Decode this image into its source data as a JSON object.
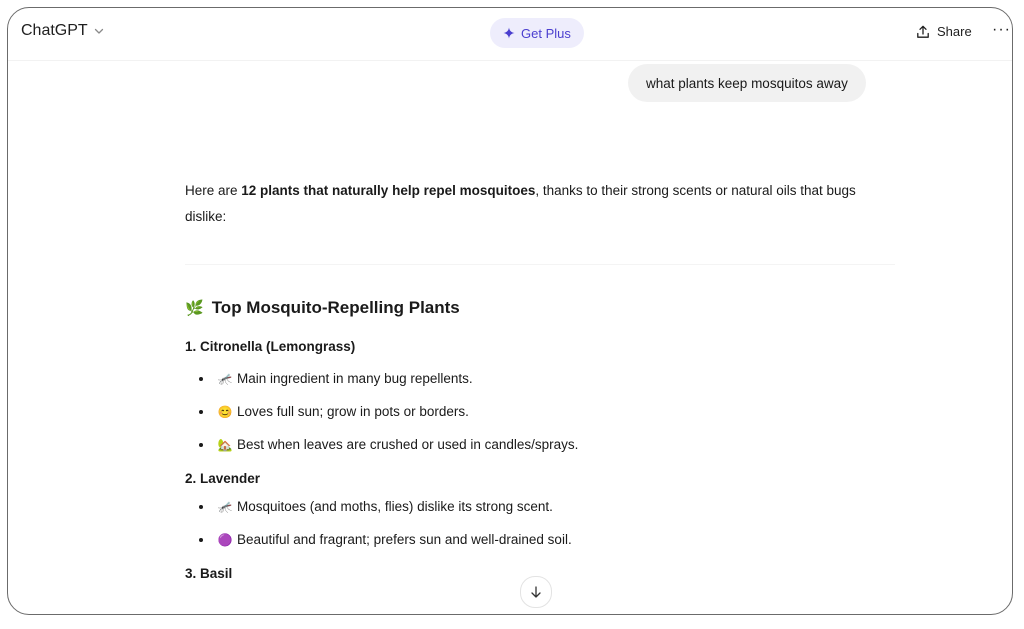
{
  "header": {
    "model_name": "ChatGPT",
    "get_plus_label": "Get Plus",
    "share_label": "Share",
    "more_label": "···"
  },
  "conversation": {
    "user_message": "what plants keep mosquitos away",
    "intro_prefix": "Here are ",
    "intro_bold": "12 plants that naturally help repel mosquitoes",
    "intro_suffix": ", thanks to their strong scents or natural oils that bugs dislike:",
    "section_emoji": "🌿",
    "section_title": "Top Mosquito-Repelling Plants",
    "plants": [
      {
        "heading": "1. Citronella (Lemongrass)",
        "bullets": [
          {
            "emoji": "🦟",
            "text": "Main ingredient in many bug repellents."
          },
          {
            "emoji": "😊",
            "text": "Loves full sun; grow in pots or borders."
          },
          {
            "emoji": "🏡",
            "text": "Best when leaves are crushed or used in candles/sprays."
          }
        ]
      },
      {
        "heading": "2. Lavender",
        "bullets": [
          {
            "emoji": "🦟",
            "text": "Mosquitoes (and moths, flies) dislike its strong scent."
          },
          {
            "emoji": "🟣",
            "text": "Beautiful and fragrant; prefers sun and well-drained soil."
          }
        ]
      },
      {
        "heading": "3. Basil",
        "bullets": []
      }
    ]
  },
  "icons": {
    "model_chevron": "chevron-down-icon",
    "get_plus": "sparkle-icon",
    "share": "share-icon",
    "more": "more-icon",
    "scroll": "arrow-down-icon"
  },
  "colors": {
    "accent": "#4b3fcf",
    "accent_bg": "#eeedfc",
    "bubble_bg": "#f1f1f1"
  }
}
